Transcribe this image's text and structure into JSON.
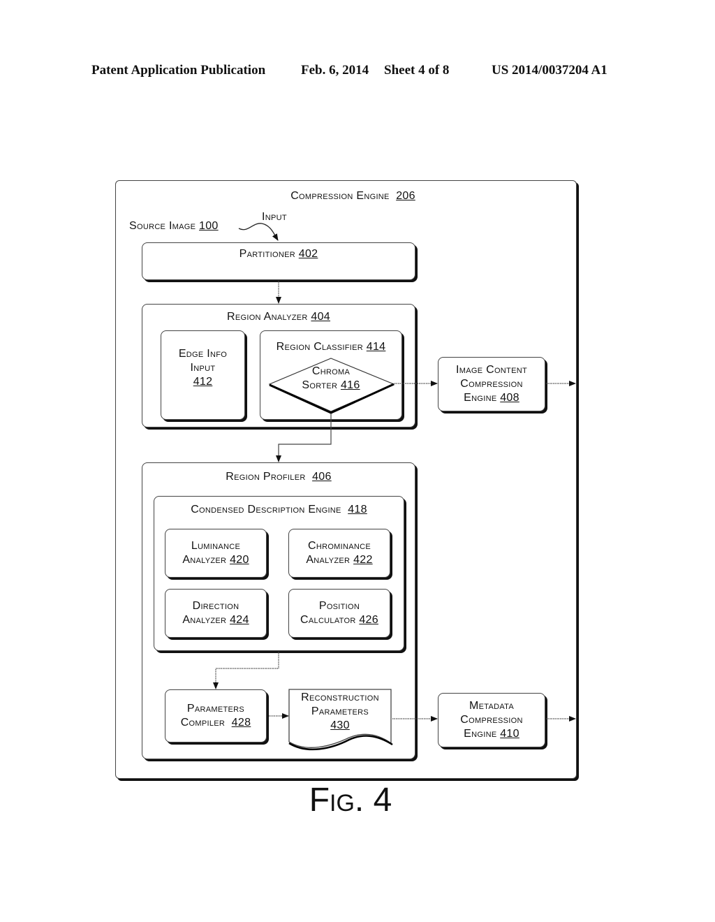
{
  "header": {
    "publication": "Patent Application Publication",
    "date": "Feb. 6, 2014",
    "sheet": "Sheet 4 of 8",
    "number": "US 2014/0037204 A1"
  },
  "diagram": {
    "compression_engine": {
      "label": "Compression Engine",
      "num": "206"
    },
    "source_image": {
      "label": "Source Image",
      "num": "100"
    },
    "input_label": "Input",
    "partitioner": {
      "label": "Partitioner",
      "num": "402"
    },
    "region_analyzer": {
      "label": "Region Analyzer",
      "num": "404"
    },
    "edge_info_input": {
      "line1": "Edge Info",
      "line2": "Input",
      "num": "412"
    },
    "region_classifier": {
      "label": "Region Classifier",
      "num": "414"
    },
    "chroma_sorter": {
      "line1": "Chroma",
      "line2": "Sorter",
      "num": "416"
    },
    "image_content_engine": {
      "line1": "Image Content",
      "line2": "Compression",
      "line3": "Engine",
      "num": "408"
    },
    "region_profiler": {
      "label": "Region Profiler",
      "num": "406"
    },
    "condensed_description_engine": {
      "label": "Condensed Description Engine",
      "num": "418"
    },
    "luminance_analyzer": {
      "line1": "Luminance",
      "line2": "Analyzer",
      "num": "420"
    },
    "chrominance_analyzer": {
      "line1": "Chrominance",
      "line2": "Analyzer",
      "num": "422"
    },
    "direction_analyzer": {
      "line1": "Direction",
      "line2": "Analyzer",
      "num": "424"
    },
    "position_calculator": {
      "line1": "Position",
      "line2": "Calculator",
      "num": "426"
    },
    "parameters_compiler": {
      "line1": "Parameters",
      "line2": "Compiler",
      "num": "428"
    },
    "reconstruction_parameters": {
      "line1": "Reconstruction",
      "line2": "Parameters",
      "num": "430"
    },
    "metadata_engine": {
      "line1": "Metadata",
      "line2": "Compression",
      "line3": "Engine",
      "num": "410"
    }
  },
  "figure_label": "Fig. 4"
}
